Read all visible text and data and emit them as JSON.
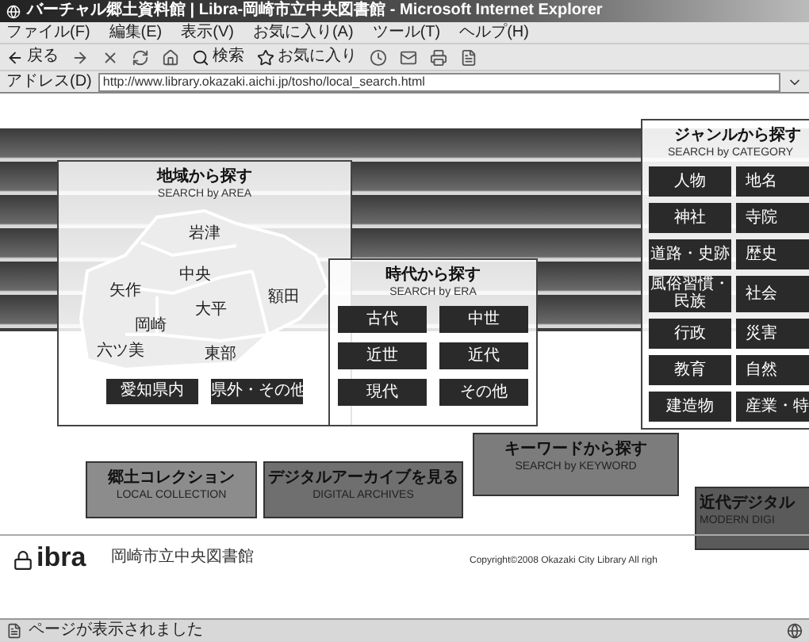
{
  "window": {
    "title": "バーチャル郷土資料館 | Libra-岡崎市立中央図書館 - Microsoft Internet Explorer"
  },
  "menu": [
    "ファイル(F)",
    "編集(E)",
    "表示(V)",
    "お気に入り(A)",
    "ツール(T)",
    "ヘルプ(H)"
  ],
  "toolbar": {
    "back_label": "戻る",
    "search_label": "検索",
    "favorites_label": "お気に入り"
  },
  "address_bar": {
    "label": "アドレス(D)",
    "url": "http://www.library.okazaki.aichi.jp/tosho/local_search.html"
  },
  "area_search": {
    "title": "地域から探す",
    "subtitle": "SEARCH by AREA",
    "districts": [
      "岩津",
      "中央",
      "矢作",
      "大平",
      "額田",
      "岡崎",
      "六ツ美",
      "東部"
    ],
    "buttons": [
      "愛知県内",
      "県外・その他"
    ]
  },
  "era_search": {
    "title": "時代から探す",
    "subtitle": "SEARCH by ERA",
    "buttons": [
      "古代",
      "中世",
      "近世",
      "近代",
      "現代",
      "その他"
    ]
  },
  "category_search": {
    "title": "ジャンルから探す",
    "subtitle": "SEARCH by CATEGORY",
    "buttons": [
      "人物",
      "地名",
      "神社",
      "寺院",
      "道路・史跡",
      "歴史",
      "風俗習慣・民族",
      "社会",
      "行政",
      "災害",
      "教育",
      "自然",
      "建造物",
      "産業・特"
    ]
  },
  "tiles": [
    {
      "title": "郷土コレクション",
      "subtitle": "LOCAL COLLECTION"
    },
    {
      "title": "デジタルアーカイブを見る",
      "subtitle": "DIGITAL ARCHIVES"
    },
    {
      "title": "キーワードから探す",
      "subtitle": "SEARCH by KEYWORD"
    },
    {
      "title": "近代デジタル",
      "subtitle": "MODERN DIGI"
    }
  ],
  "footer": {
    "logo": "ibra",
    "site_name": "岡崎市立中央図書館",
    "copyright": "Copyright©2008 Okazaki City Library All righ"
  },
  "status_bar": {
    "text": "ページが表示されました"
  }
}
